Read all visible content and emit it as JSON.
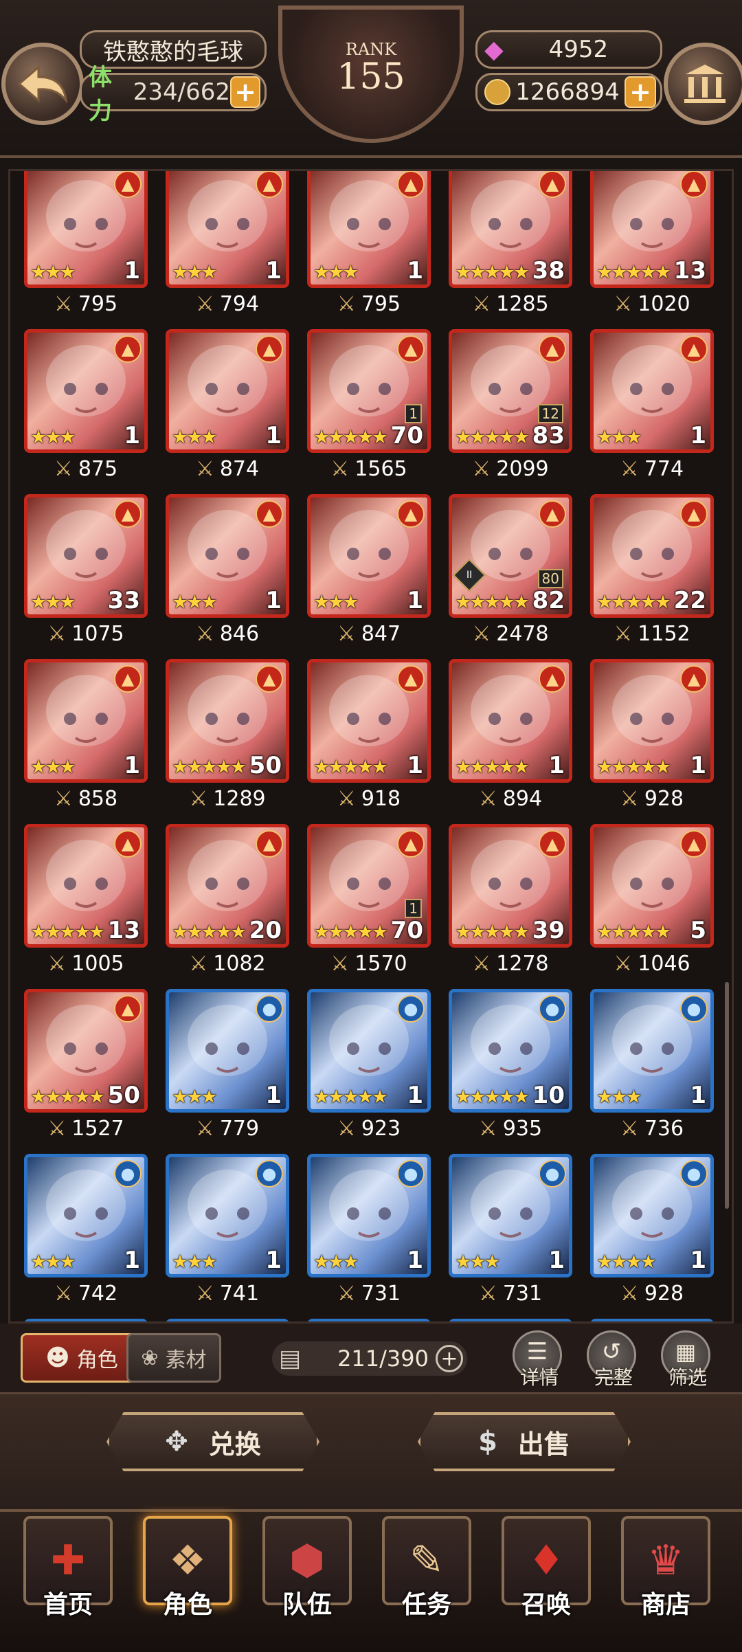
{
  "header": {
    "player_name": "铁憨憨的毛球",
    "stamina_label": "体力",
    "stamina_value": "234/662",
    "rank_label": "RANK",
    "rank_value": "155",
    "gems": "4952",
    "gold": "1266894",
    "plus": "+"
  },
  "roster": {
    "star_char": "★",
    "power_icon": "⚔",
    "rows": [
      [
        {
          "element": "fire",
          "stars": 3,
          "level": "1",
          "power": "795"
        },
        {
          "element": "fire",
          "stars": 3,
          "level": "1",
          "power": "794"
        },
        {
          "element": "fire",
          "stars": 3,
          "level": "1",
          "power": "795"
        },
        {
          "element": "fire",
          "stars": 5,
          "level": "38",
          "power": "1285"
        },
        {
          "element": "fire",
          "stars": 5,
          "level": "13",
          "power": "1020"
        }
      ],
      [
        {
          "element": "fire",
          "stars": 3,
          "level": "1",
          "power": "875"
        },
        {
          "element": "fire",
          "stars": 3,
          "level": "1",
          "power": "874"
        },
        {
          "element": "fire",
          "stars": 5,
          "level": "70",
          "badge": "1",
          "power": "1565"
        },
        {
          "element": "fire",
          "stars": 5,
          "level": "83",
          "badge": "12",
          "power": "2099"
        },
        {
          "element": "fire",
          "stars": 3,
          "level": "1",
          "power": "774"
        }
      ],
      [
        {
          "element": "fire",
          "stars": 3,
          "level": "33",
          "power": "1075"
        },
        {
          "element": "fire",
          "stars": 3,
          "level": "1",
          "power": "846"
        },
        {
          "element": "fire",
          "stars": 3,
          "level": "1",
          "power": "847"
        },
        {
          "element": "fire",
          "stars": 5,
          "level": "82",
          "badge": "80",
          "gem": "II",
          "power": "2478"
        },
        {
          "element": "fire",
          "stars": 5,
          "level": "22",
          "power": "1152"
        }
      ],
      [
        {
          "element": "fire",
          "stars": 3,
          "level": "1",
          "power": "858"
        },
        {
          "element": "fire",
          "stars": 5,
          "level": "50",
          "power": "1289"
        },
        {
          "element": "fire",
          "stars": 5,
          "level": "1",
          "power": "918"
        },
        {
          "element": "fire",
          "stars": 5,
          "level": "1",
          "power": "894"
        },
        {
          "element": "fire",
          "stars": 5,
          "level": "1",
          "power": "928"
        }
      ],
      [
        {
          "element": "fire",
          "stars": 5,
          "level": "13",
          "power": "1005"
        },
        {
          "element": "fire",
          "stars": 5,
          "level": "20",
          "power": "1082"
        },
        {
          "element": "fire",
          "stars": 5,
          "level": "70",
          "badge": "1",
          "power": "1570"
        },
        {
          "element": "fire",
          "stars": 5,
          "level": "39",
          "power": "1278"
        },
        {
          "element": "fire",
          "stars": 5,
          "level": "5",
          "power": "1046"
        }
      ],
      [
        {
          "element": "fire",
          "stars": 5,
          "level": "50",
          "power": "1527"
        },
        {
          "element": "water",
          "stars": 3,
          "level": "1",
          "power": "779"
        },
        {
          "element": "water",
          "stars": 5,
          "level": "1",
          "power": "923"
        },
        {
          "element": "water",
          "stars": 5,
          "level": "10",
          "power": "935"
        },
        {
          "element": "water",
          "stars": 3,
          "level": "1",
          "power": "736"
        }
      ],
      [
        {
          "element": "water",
          "stars": 3,
          "level": "1",
          "power": "742"
        },
        {
          "element": "water",
          "stars": 3,
          "level": "1",
          "power": "741"
        },
        {
          "element": "water",
          "stars": 3,
          "level": "1",
          "power": "731"
        },
        {
          "element": "water",
          "stars": 3,
          "level": "1",
          "power": "731"
        },
        {
          "element": "water",
          "stars": 4,
          "level": "1",
          "power": "928"
        }
      ]
    ]
  },
  "toolbar": {
    "tab_characters": "角色",
    "tab_materials": "素材",
    "capacity": "211/390",
    "details": "详情",
    "complete": "完整",
    "filter": "筛选"
  },
  "actions": {
    "exchange": "兑换",
    "sell": "出售"
  },
  "nav": {
    "home": "首页",
    "characters": "角色",
    "team": "队伍",
    "quests": "任务",
    "summon": "召唤",
    "shop": "商店"
  },
  "colors": {
    "fire_frame": "#c4281c",
    "water_frame": "#2a73c6",
    "accent_orange": "#e39a2c",
    "star_gold": "#ffd23a"
  }
}
